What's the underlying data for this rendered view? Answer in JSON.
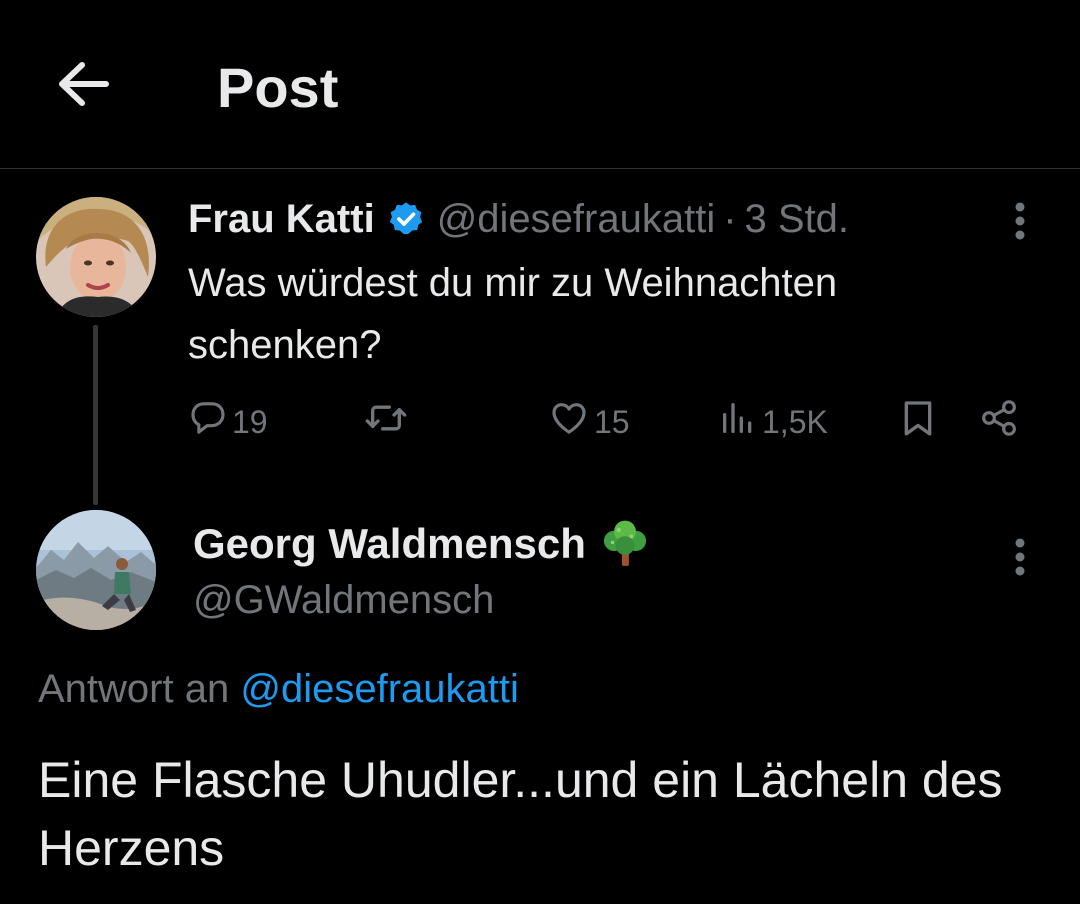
{
  "header": {
    "title": "Post",
    "back_icon": "arrow-left-icon"
  },
  "original_post": {
    "author_name": "Frau Katti",
    "verified": true,
    "handle": "@diesefraukatti",
    "separator": "·",
    "time": "3 Std.",
    "text": "Was würdest du mir zu Weihnachten schenken?",
    "actions": {
      "replies": "19",
      "reposts": "",
      "likes": "15",
      "views": "1,5K"
    }
  },
  "reply_post": {
    "author_name": "Georg Waldmensch",
    "name_emoji": "deciduous-tree-emoji",
    "handle": "@GWaldmensch",
    "reply_to_prefix": "Antwort an",
    "reply_to_handle": "@diesefraukatti",
    "text": "Eine Flasche Uhudler...und ein Lächeln des Herzens"
  },
  "colors": {
    "background": "#000000",
    "text_primary": "#e7e9ea",
    "text_secondary": "#71767b",
    "accent": "#1d9bf0",
    "divider": "#2f3336"
  }
}
